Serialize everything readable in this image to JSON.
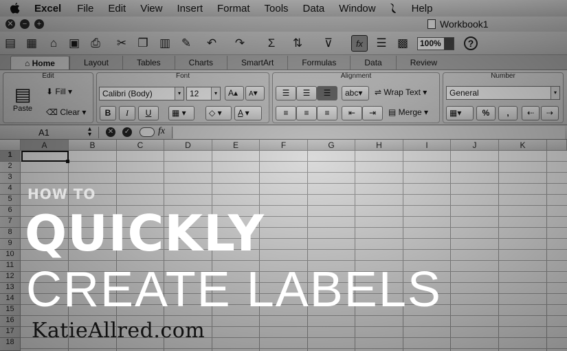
{
  "menubar": {
    "items": [
      "Excel",
      "File",
      "Edit",
      "View",
      "Insert",
      "Format",
      "Tools",
      "Data",
      "Window",
      "Help"
    ]
  },
  "window": {
    "title": "Workbook1",
    "buttons": [
      "close-icon",
      "minimize-icon",
      "zoom-icon"
    ]
  },
  "toolbar": {
    "zoom": "100%",
    "help_label": "?",
    "icons": [
      "new-icon",
      "templates-icon",
      "open-icon",
      "save-icon",
      "print-icon",
      "cut-icon",
      "copy-icon",
      "paste-icon",
      "format-painter-icon",
      "undo-icon",
      "redo-icon",
      "autosum-icon",
      "sort-icon",
      "filter-icon",
      "function-icon",
      "toolbox-icon",
      "media-icon"
    ]
  },
  "ribbon_tabs": [
    "Home",
    "Layout",
    "Tables",
    "Charts",
    "SmartArt",
    "Formulas",
    "Data",
    "Review"
  ],
  "ribbon": {
    "edit": {
      "label": "Edit",
      "paste": "Paste",
      "fill": "Fill",
      "clear": "Clear"
    },
    "font": {
      "label": "Font",
      "font_name": "Calibri (Body)",
      "font_size": "12",
      "bold": "B",
      "italic": "I",
      "underline": "U",
      "grow": "A",
      "shrink": "A",
      "color_a": "A"
    },
    "alignment": {
      "label": "Alignment",
      "abc": "abc",
      "wrap": "Wrap Text",
      "merge": "Merge"
    },
    "number": {
      "label": "Number",
      "format": "General",
      "percent": "%",
      "comma": ","
    }
  },
  "formula_bar": {
    "cell": "A1",
    "fx": "fx"
  },
  "grid": {
    "columns": [
      "A",
      "B",
      "C",
      "D",
      "E",
      "F",
      "G",
      "H",
      "I",
      "J",
      "K"
    ],
    "rows": [
      "1",
      "2",
      "3",
      "4",
      "5",
      "6",
      "7",
      "8",
      "9",
      "10",
      "11",
      "12",
      "13",
      "14",
      "15",
      "16",
      "17",
      "18"
    ]
  },
  "overlay": {
    "how_to": "HOW TO",
    "quickly": "QUICKLY",
    "create": "CREATE LABELS",
    "site": "KatieAllred.com"
  }
}
